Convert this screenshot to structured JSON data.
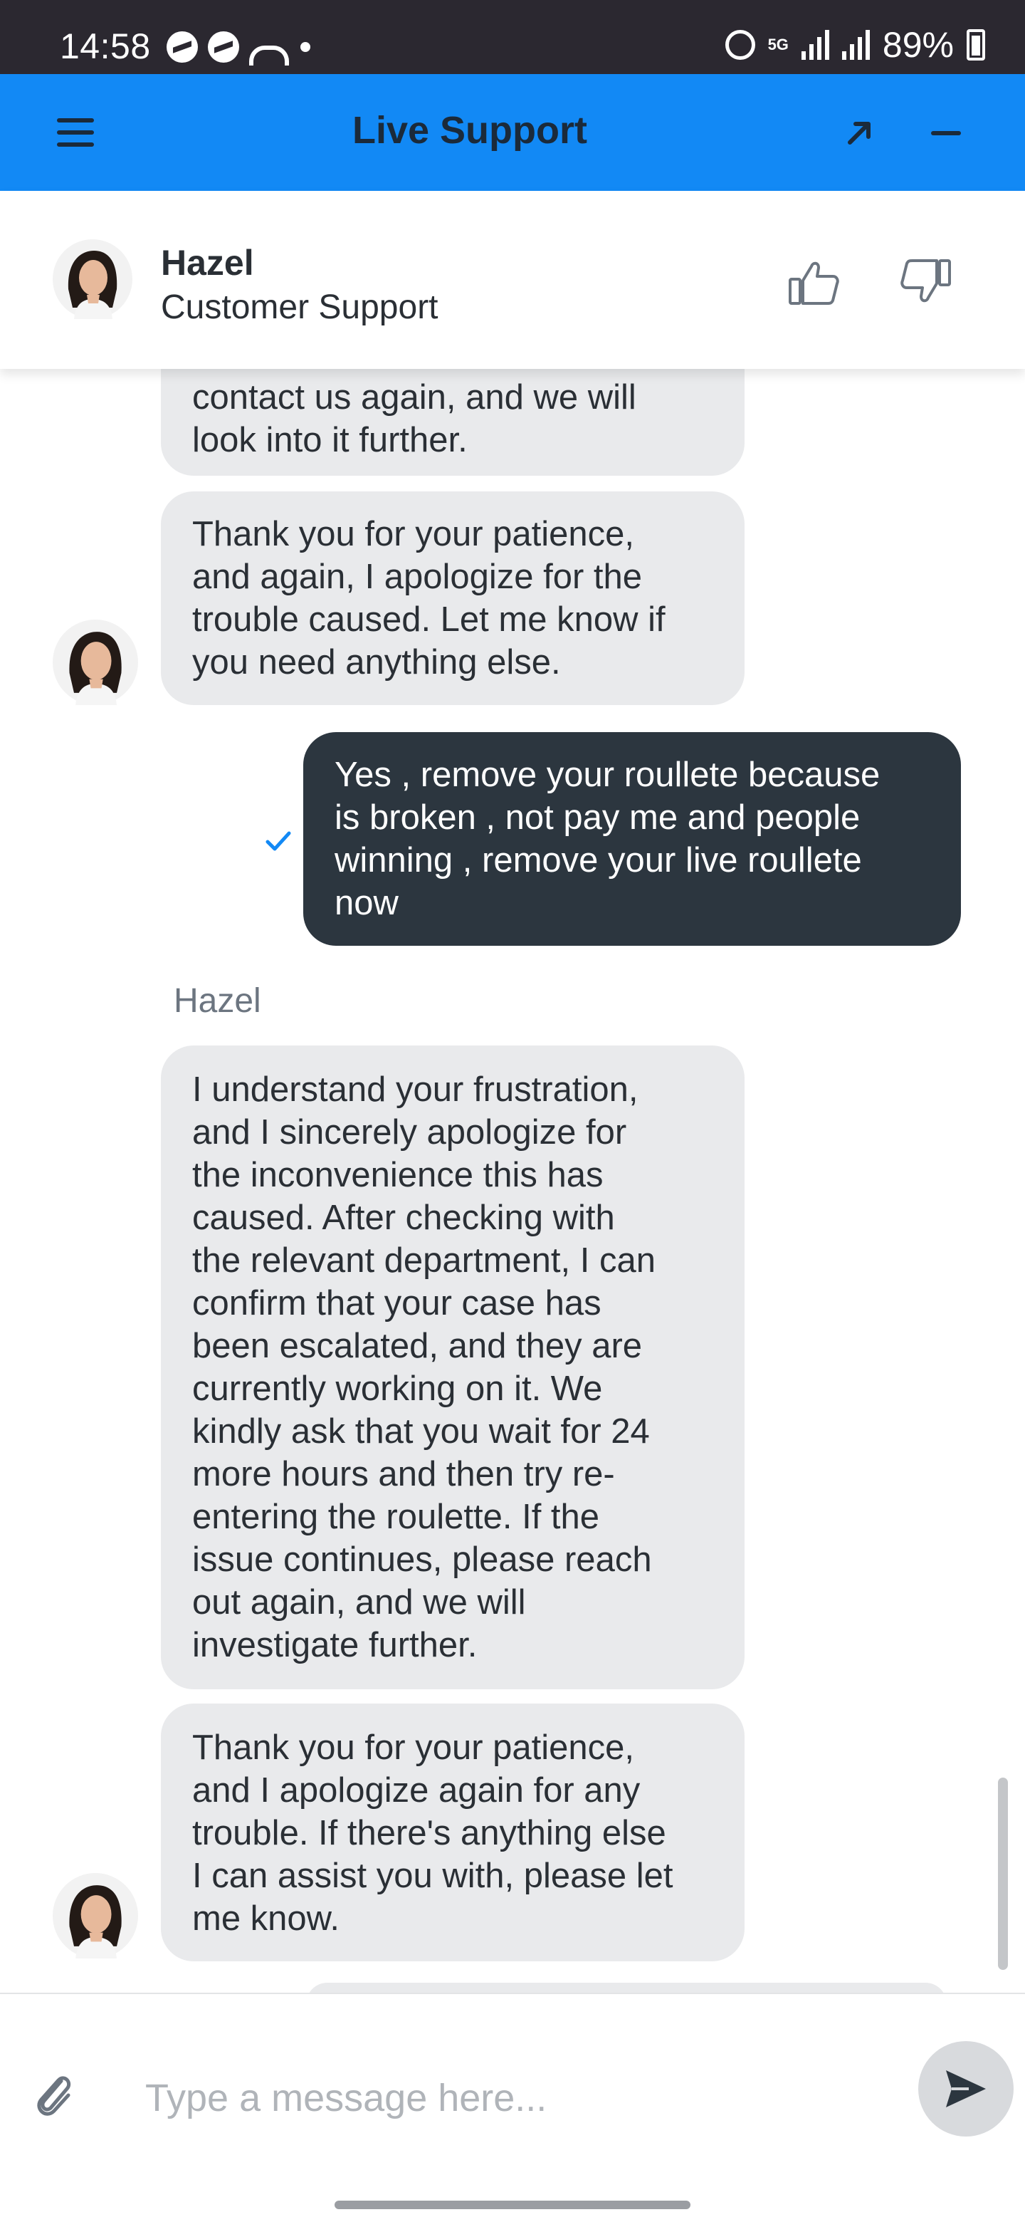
{
  "status_bar": {
    "time": "14:58",
    "network_type": "5G",
    "battery_percent": "89%",
    "icons": [
      "messenger-icon",
      "messenger-icon",
      "missed-call-icon",
      "notification-dot",
      "alarm-icon",
      "signal-icon",
      "battery-icon"
    ]
  },
  "header": {
    "title": "Live Support",
    "background_color": "#1289f5",
    "icons": [
      "menu-icon",
      "popout-icon",
      "minimize-icon"
    ]
  },
  "agent": {
    "name": "Hazel",
    "role": "Customer Support",
    "icons": [
      "thumb-up-icon",
      "thumb-down-icon"
    ]
  },
  "messages": [
    {
      "from": "agent",
      "text": "contact us again, and we will\nlook into it further.",
      "partial": true
    },
    {
      "from": "agent",
      "text": "Thank you for your patience,\nand again, I apologize for the\ntrouble caused. Let me know if\nyou need anything else."
    },
    {
      "from": "user",
      "text": "Yes , remove your roullete because\nis broken , not pay me and people\nwinning , remove your live roullete\nnow",
      "status": "read"
    },
    {
      "from": "agent",
      "sender_label": "Hazel",
      "text": "I understand your frustration,\nand I sincerely apologize for\nthe inconvenience this has\ncaused. After checking with\nthe relevant department, I can\nconfirm that your case has\nbeen escalated, and they are\ncurrently working on it. We\nkindly ask that you wait for 24\nmore hours and then try re-\nentering the roulette. If the\nissue continues, please reach\nout again, and we will\ninvestigate further."
    },
    {
      "from": "agent",
      "text": "Thank you for your patience,\nand I apologize again for any\ntrouble. If there's anything else\nI can assist you with, please let\nme know."
    }
  ],
  "composer": {
    "placeholder": "Type a message here...",
    "value": "",
    "icons": [
      "attach-icon",
      "send-icon"
    ]
  },
  "colors": {
    "user_bubble": "#2c363f",
    "agent_bubble": "#e9eaec",
    "read_check": "#1289f5"
  }
}
